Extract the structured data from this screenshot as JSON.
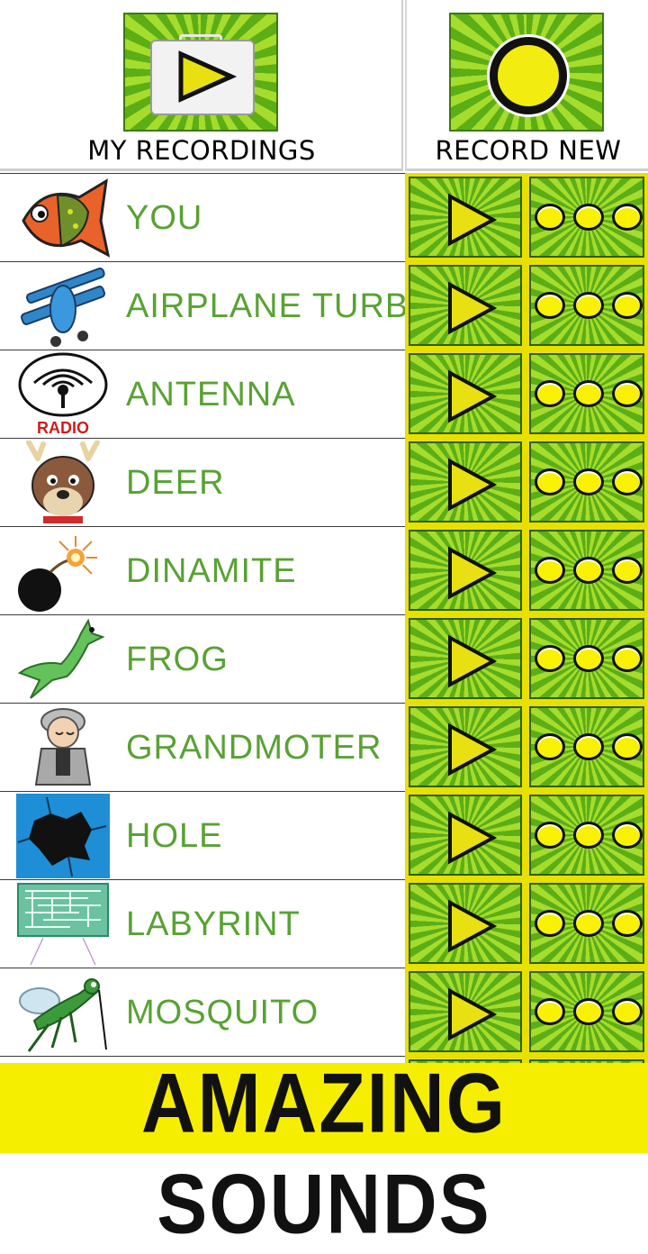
{
  "header": {
    "my_recordings_label": "MY RECORDINGS",
    "record_new_label": "RECORD NEW"
  },
  "sounds": [
    {
      "name": "YOU",
      "icon": "fish-icon"
    },
    {
      "name": "AIRPLANE TURBINE",
      "icon": "airplane-icon"
    },
    {
      "name": "ANTENNA",
      "icon": "radio-antenna-icon",
      "icon_caption": "RADIO"
    },
    {
      "name": "DEER",
      "icon": "deer-icon"
    },
    {
      "name": "DINAMITE",
      "icon": "bomb-icon"
    },
    {
      "name": "FROG",
      "icon": "frog-icon"
    },
    {
      "name": "GRANDMOTER",
      "icon": "grandmother-icon"
    },
    {
      "name": "HOLE",
      "icon": "hole-icon"
    },
    {
      "name": "LABYRINT",
      "icon": "maze-icon"
    },
    {
      "name": "MOSQUITO",
      "icon": "mosquito-icon"
    }
  ],
  "banner": {
    "text": "AMAZING SOUNDS"
  },
  "colors": {
    "accent_green": "#5cae16",
    "label_green": "#58a233",
    "yellow": "#f6ee00"
  }
}
